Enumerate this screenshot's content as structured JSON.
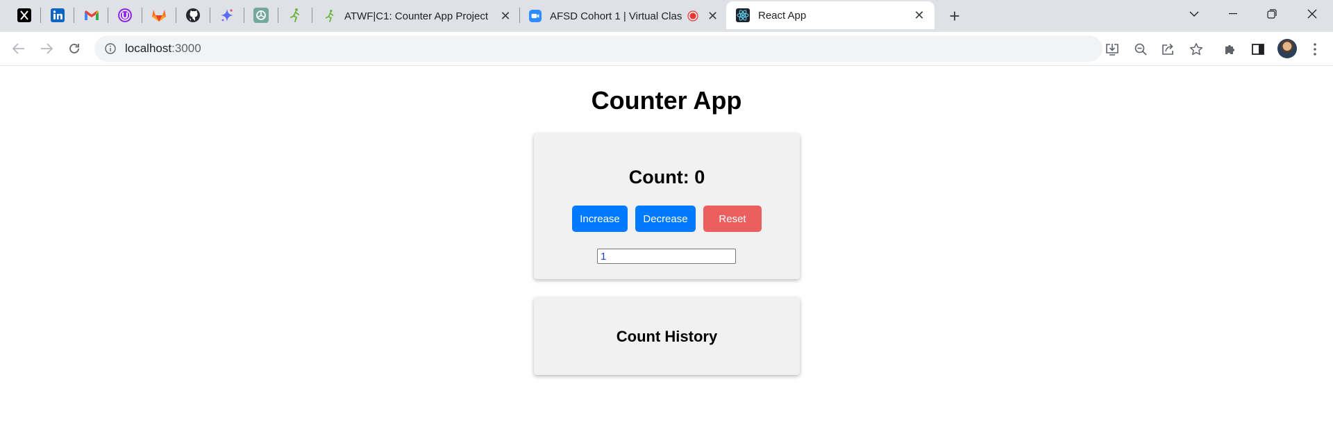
{
  "browser": {
    "pinned_tabs": [
      {
        "icon": "x-logo-icon"
      },
      {
        "icon": "linkedin-icon"
      },
      {
        "icon": "gmail-icon"
      },
      {
        "icon": "u-badge-icon"
      },
      {
        "icon": "gitlab-icon"
      },
      {
        "icon": "github-icon"
      },
      {
        "icon": "sparkle-icon"
      },
      {
        "icon": "chatgpt-icon"
      },
      {
        "icon": "runner-icon"
      }
    ],
    "tabs": [
      {
        "title": "ATWF|C1: Counter App Project",
        "icon": "runner-icon",
        "active": false
      },
      {
        "title": "AFSD Cohort 1 | Virtual Clas",
        "icon": "zoom-icon",
        "active": false,
        "recording": true
      },
      {
        "title": "React App",
        "icon": "react-icon",
        "active": true
      }
    ],
    "close_glyph": "✕",
    "new_tab_glyph": "+",
    "address": {
      "host": "localhost",
      "port": ":3000"
    },
    "colors": {
      "tab_strip": "#dee1e6",
      "omnibox": "#f1f3f4",
      "record": "#e8372f"
    }
  },
  "app": {
    "title": "Counter App",
    "count_label": "Count: 0",
    "buttons": {
      "increase": "Increase",
      "decrease": "Decrease",
      "reset": "Reset"
    },
    "step_value": "1",
    "history_title": "Count History",
    "colors": {
      "primary": "#007bff",
      "danger": "#ec5f5f",
      "card": "#f1f1f1"
    }
  }
}
